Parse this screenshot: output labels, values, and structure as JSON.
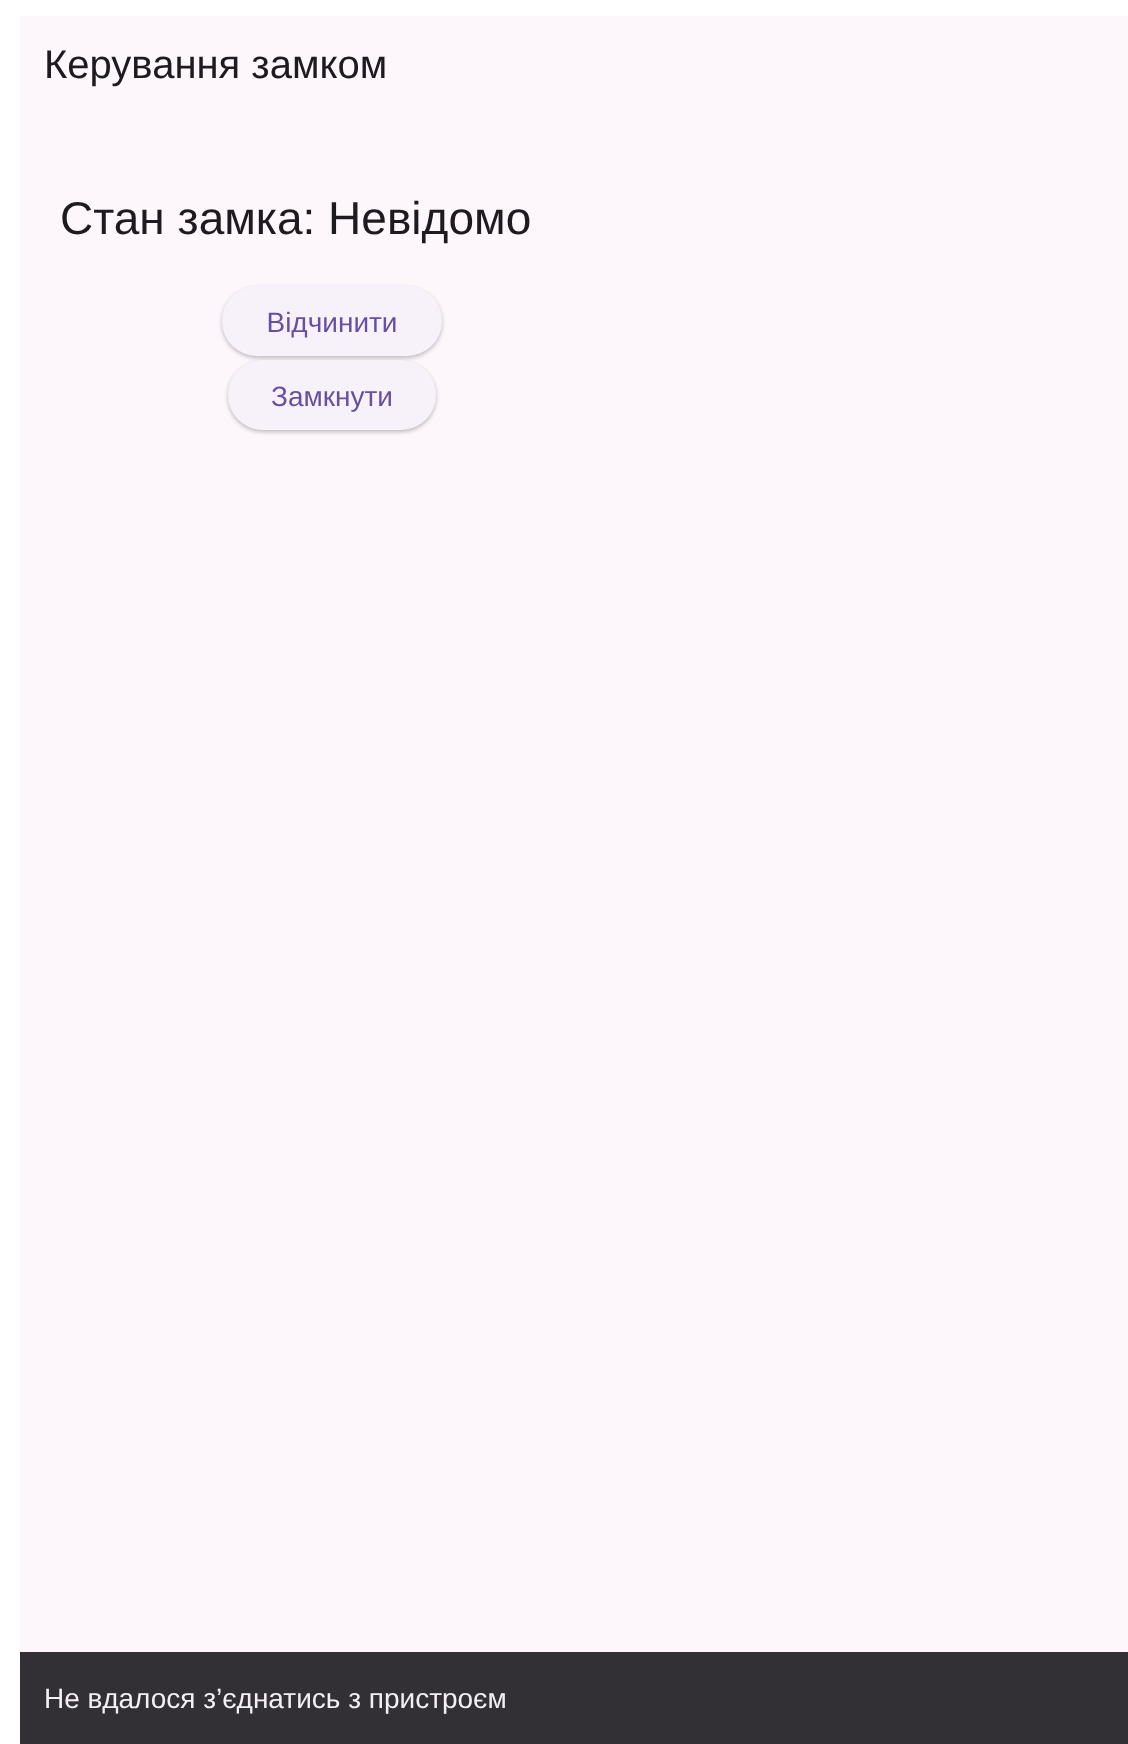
{
  "app_bar": {
    "title": "Керування замком"
  },
  "status": {
    "text": "Стан замка: Невідомо"
  },
  "buttons": [
    {
      "label": "Відчинити"
    },
    {
      "label": "Замкнути"
    }
  ],
  "snackbar": {
    "message": "Не вдалося з’єднатись з пристроєм"
  }
}
